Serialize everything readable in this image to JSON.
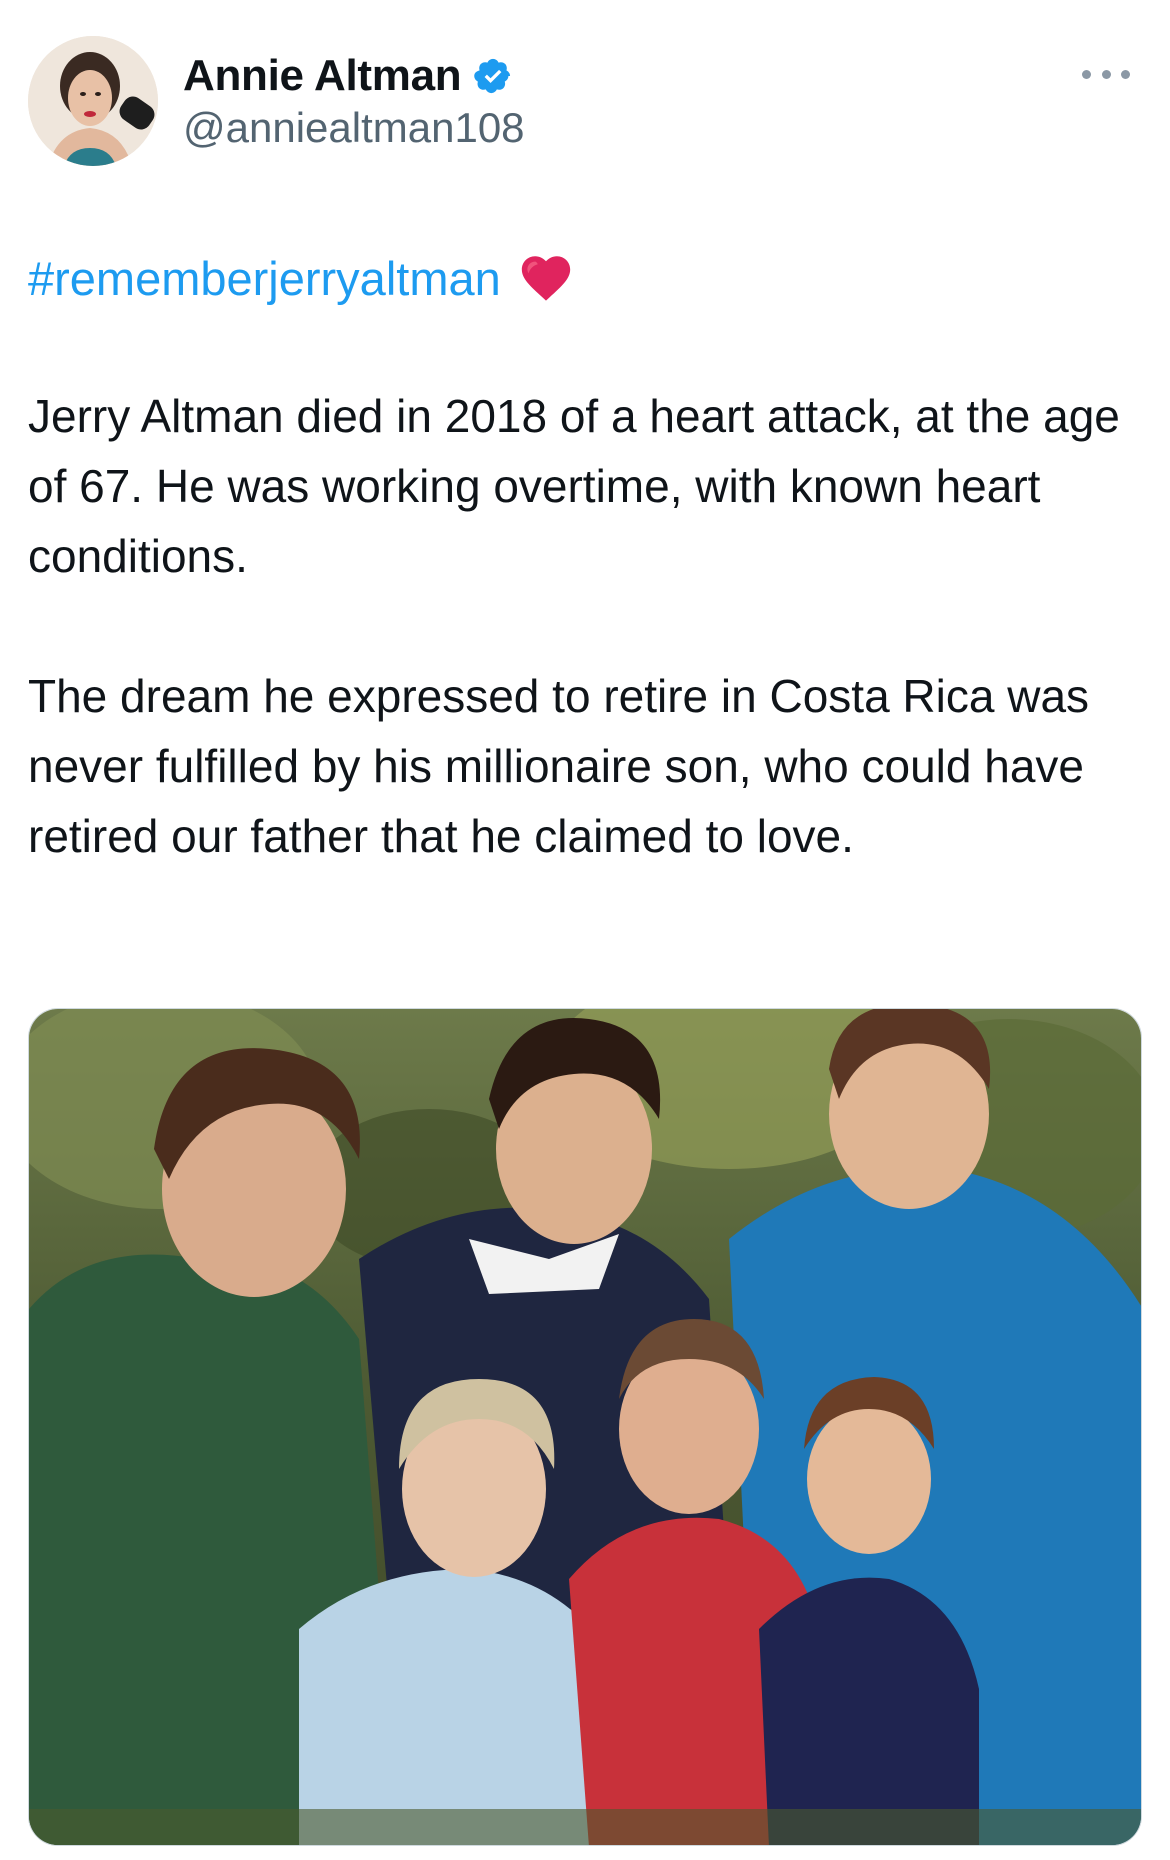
{
  "tweet": {
    "author": {
      "display_name": "Annie Altman",
      "handle": "@anniealtman108",
      "verified": true,
      "avatar_icon": "avatar-photo"
    },
    "more_icon": "ellipsis-icon",
    "hashtag": "#rememberjerryaltman",
    "hashtag_emoji": "heart-icon",
    "paragraphs": [
      "Jerry Altman died in 2018 of a heart attack, at the age of 67. He was working overtime, with known heart conditions.",
      "The dream he expressed to retire in Costa Rica was never fulfilled by his millionaire son, who could have retired our father that he claimed to love."
    ],
    "media": {
      "type": "photo",
      "icon": "family-photo"
    }
  },
  "colors": {
    "link": "#1d9bf0",
    "text": "#0f1419",
    "secondary_text": "#536471",
    "verified_badge": "#1d9bf0",
    "heart": "#e0245e",
    "background": "#ffffff"
  }
}
